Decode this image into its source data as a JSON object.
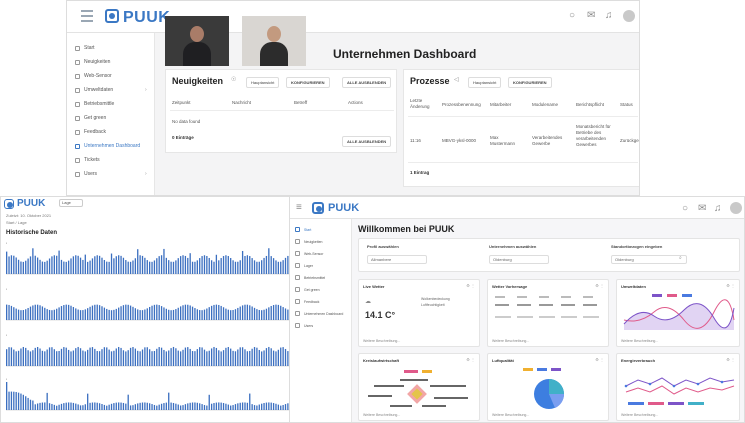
{
  "colors": {
    "brand": "#3b78c4",
    "sidebar_bg": "#ffffff",
    "canvas_bg": "#f4f4f5",
    "chart_bar": "#3b6fc0"
  },
  "shot1": {
    "brand": "PUUK",
    "page_title": "Unternehmen Dashboard",
    "sidebar": [
      {
        "label": "Start",
        "icon": "home-icon"
      },
      {
        "label": "Neuigkeiten",
        "icon": "news-icon"
      },
      {
        "label": "Web-Sensor",
        "icon": "sensor-icon"
      },
      {
        "label": "Umweltdaten",
        "icon": "leaf-icon",
        "expandable": true
      },
      {
        "label": "Betriebsmittle",
        "icon": "tools-icon"
      },
      {
        "label": "Get green",
        "icon": "plant-icon"
      },
      {
        "label": "Feedback",
        "icon": "feedback-icon"
      },
      {
        "label": "Unternehmen Dashboard",
        "icon": "dashboard-icon",
        "active": true
      },
      {
        "label": "Tickets",
        "icon": "ticket-icon"
      },
      {
        "label": "Users",
        "icon": "users-icon",
        "expandable": true
      }
    ],
    "news_card": {
      "title": "Neuigkeiten",
      "view_select": "Hauptansicht",
      "configure": "KONFIGURIEREN",
      "hide_all": "ALLE AUSBLENDEN",
      "columns": [
        "Zeitpunkt",
        "Nachricht",
        "Betreff",
        "Actions"
      ],
      "empty": "No data found",
      "count": "0 Einträge",
      "footer_hide_all": "ALLE AUSBLENDEN"
    },
    "process_card": {
      "title": "Prozesse",
      "view_select": "Hauptansicht",
      "configure": "KONFIGURIEREN",
      "columns": [
        "Letzte Änderung",
        "Prozessbenennung",
        "Mitarbeiter",
        "Modulename",
        "Berichtspflicht",
        "Status"
      ],
      "row": [
        "11:16",
        "MBVG-yksl-0000",
        "Max Mustermann",
        "Verarbeitendes Gewerbe",
        "Monatsbericht für Betriebe des verarbeitenden Gewerbes",
        "Zurückge"
      ],
      "count": "1 Eintrag"
    }
  },
  "shot2": {
    "brand": "PUUK",
    "select": "Lage",
    "subtitle": "Zuletzt: 10. Oktober 2021",
    "breadcrumb": "Start / Lage",
    "title": "Historische Daten"
  },
  "shot3": {
    "brand": "PUUK",
    "welcome": "Willkommen bei PUUK",
    "sidebar": [
      "Start",
      "Neuigkeiten",
      "Web-Sensor",
      "Lager",
      "Betriebsmittel",
      "Get green",
      "Feedback",
      "Unternehmen Dashboard",
      "Users"
    ],
    "filters": [
      {
        "label": "Profil auswählen",
        "value": "Allmanbere"
      },
      {
        "label": "Unternehmen auswählen",
        "value": "Oldenburg"
      },
      {
        "label": "Standortbezogen eingeben",
        "value": "Oldenburg"
      }
    ],
    "widgets": [
      {
        "title": "Live Wetter",
        "value": "14.1 C°",
        "meta": "Wolkenbedeckung\nLuftfeuchtigkeit",
        "footer": "Weitere Beschreibung..."
      },
      {
        "title": "Wetter Vorhersage",
        "footer": "Weitere Beschreibung..."
      },
      {
        "title": "Umweltdaten",
        "footer": "Weitere Beschreibung..."
      },
      {
        "title": "Kreislaufwirtschaft",
        "footer": "Weitere Beschreibung..."
      },
      {
        "title": "Luftqualität",
        "footer": "Weitere Beschreibung..."
      },
      {
        "title": "Energieverbrauch",
        "footer": "Weitere Beschreibung..."
      }
    ]
  }
}
